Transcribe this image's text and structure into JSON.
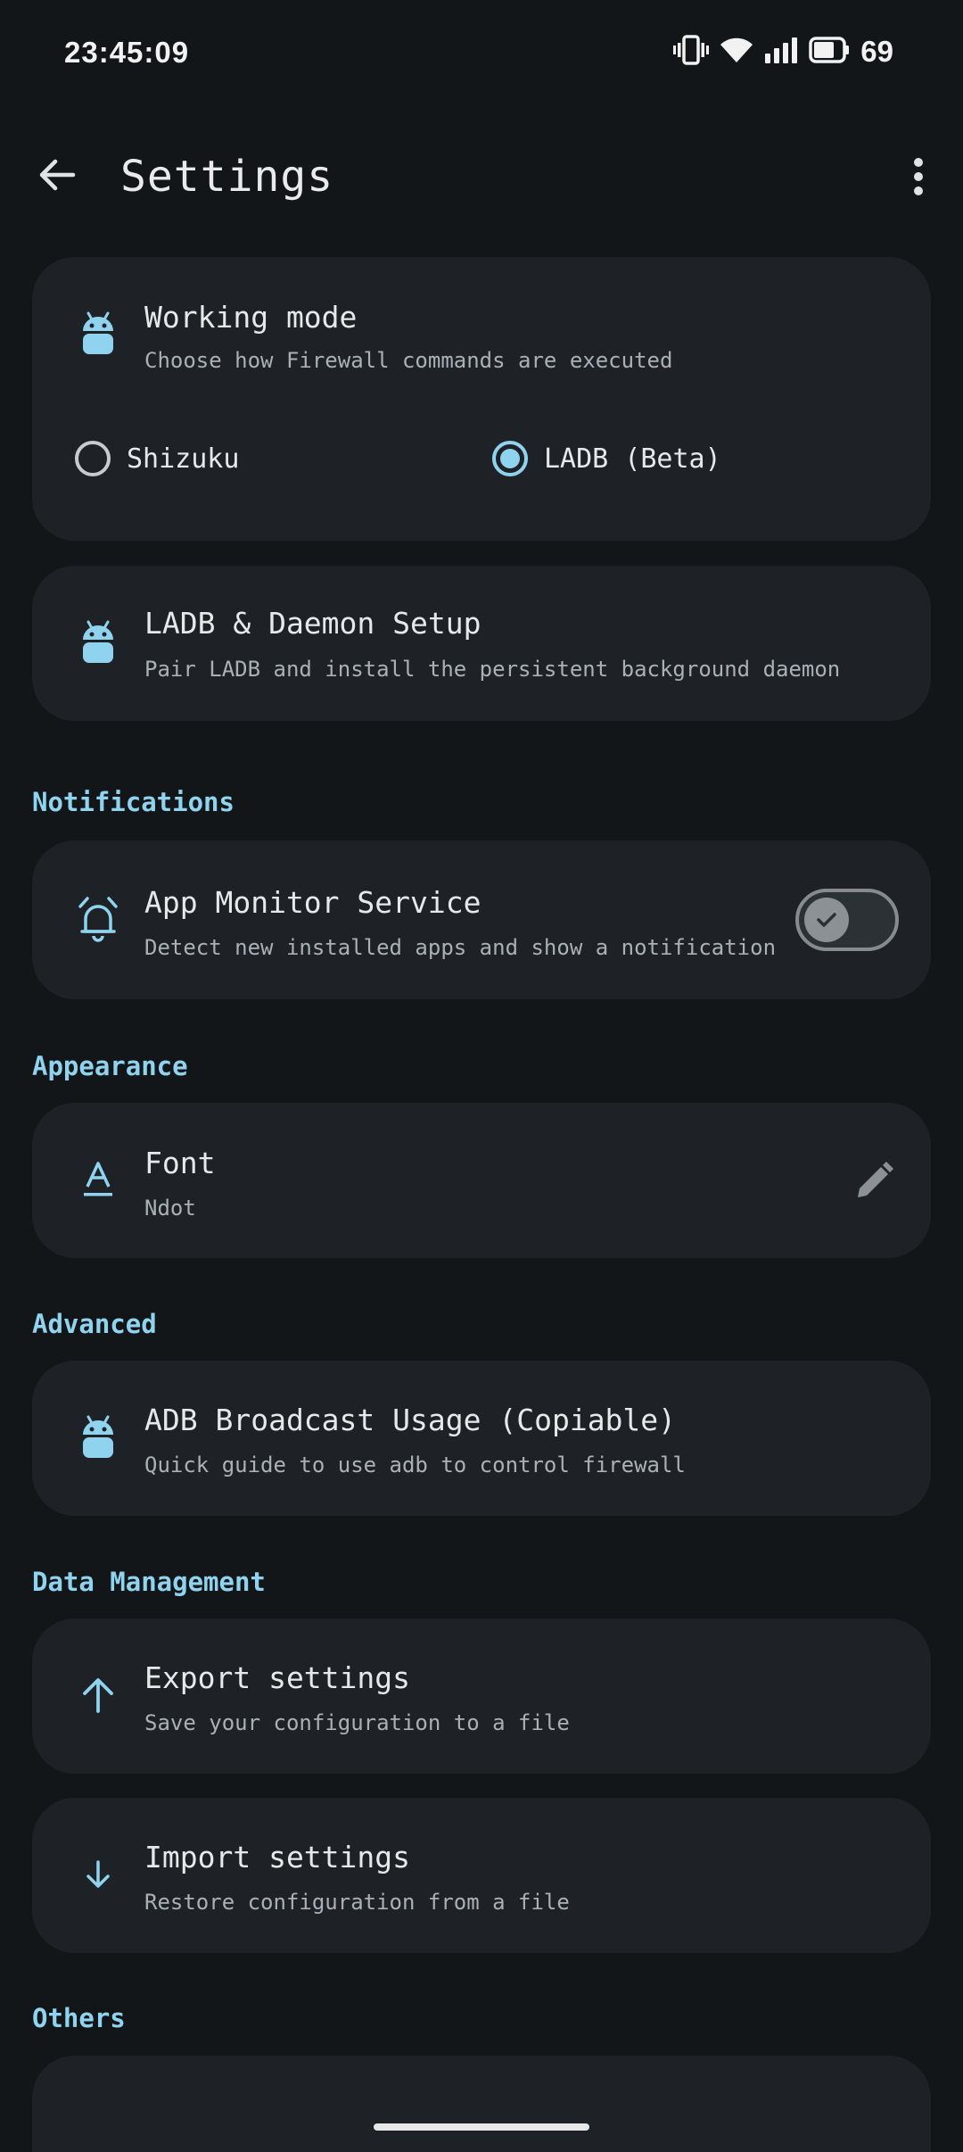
{
  "status_bar": {
    "time": "23:45:09",
    "battery": "69"
  },
  "topbar": {
    "title": "Settings"
  },
  "working_mode": {
    "title": "Working mode",
    "subtitle": "Choose how Firewall commands are executed",
    "options": [
      {
        "label": "Shizuku",
        "selected": false
      },
      {
        "label": "LADB (Beta)",
        "selected": true
      }
    ]
  },
  "ladb_setup": {
    "title": "LADB & Daemon Setup",
    "subtitle": "Pair LADB and install the persistent background daemon"
  },
  "sections": {
    "notifications": "Notifications",
    "appearance": "Appearance",
    "advanced": "Advanced",
    "data_management": "Data Management",
    "others": "Others"
  },
  "app_monitor": {
    "title": "App Monitor Service",
    "subtitle": "Detect new installed apps and show a notification",
    "enabled": true
  },
  "font": {
    "title": "Font",
    "subtitle": "Ndot"
  },
  "adb_broadcast": {
    "title": "ADB Broadcast Usage (Copiable)",
    "subtitle": "Quick guide to use adb to control firewall"
  },
  "export": {
    "title": "Export settings",
    "subtitle": "Save your configuration to a file"
  },
  "import": {
    "title": "Import settings",
    "subtitle": "Restore configuration from a file"
  },
  "colors": {
    "accent": "#8fd3ee",
    "card": "#1e2226",
    "background": "#121619"
  }
}
